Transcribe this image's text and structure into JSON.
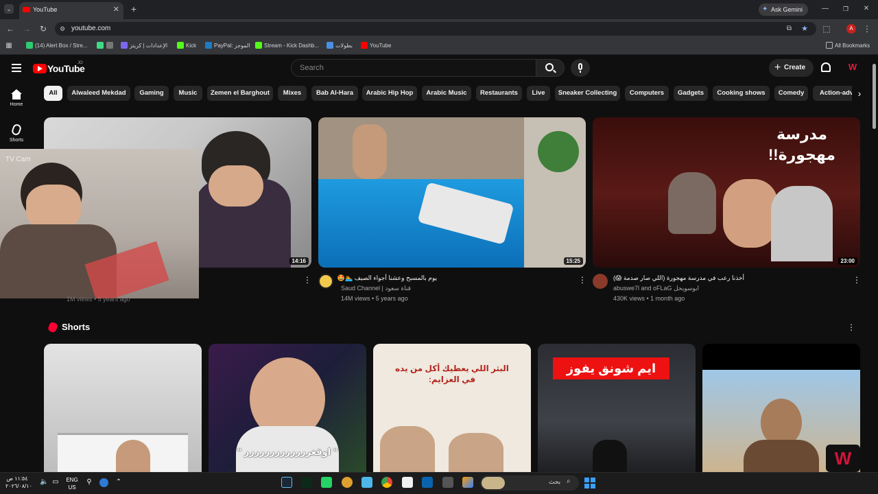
{
  "browser": {
    "tab_title": "YouTube",
    "new_tab": "+",
    "url": "youtube.com",
    "ask_gemini": "Ask Gemini",
    "profile_initial": "A",
    "bookmarks": [
      {
        "label": "(14) Alert Box / Stre...",
        "color": "#2ecc71"
      },
      {
        "label": "",
        "color": "#3ddc84"
      },
      {
        "label": "",
        "color": "#777777"
      },
      {
        "label": "الإعدادات | كريتز",
        "color": "#7b68ee"
      },
      {
        "label": "Kick",
        "color": "#53fc18"
      },
      {
        "label": "PayPal: الموجز",
        "color": "#1f7bc1"
      },
      {
        "label": "Stream - Kick Dashb...",
        "color": "#53fc18"
      },
      {
        "label": "بطولات",
        "color": "#4a90e2"
      },
      {
        "label": "YouTube",
        "color": "#ff0000"
      }
    ],
    "all_bookmarks": "All Bookmarks"
  },
  "yt": {
    "logo_text": "YouTube",
    "country": "JO",
    "search_placeholder": "Search",
    "create_label": "Create",
    "nav": [
      {
        "label": "Home",
        "icon": "home-icon"
      },
      {
        "label": "Shorts",
        "icon": "shorts-icon"
      }
    ],
    "chips": [
      "All",
      "Alwaleed Mekdad",
      "Gaming",
      "Music",
      "Zemen el Barghout",
      "Mixes",
      "Bab Al-Hara",
      "Arabic Hip Hop",
      "Arabic Music",
      "Restaurants",
      "Live",
      "Sneaker Collecting",
      "Computers",
      "Gadgets",
      "Cooking shows",
      "Comedy",
      "Action-adv"
    ],
    "videos": [
      {
        "duration": "14:16",
        "title": "",
        "channel": "",
        "meta": "1M views • 5 years ago",
        "overlay_label": "TV Cam"
      },
      {
        "duration": "15:25",
        "title": "يوم بالمسبح وعشنا أجواء الصيف 🏊🤩",
        "channel": "Saud Channel | قناة سعود",
        "meta": "14M views • 5 years ago"
      },
      {
        "duration": "23:00",
        "title": "أخذنا رعب في مدرسة مهجورة (اللي صار صدمة 😱)",
        "channel": "abuswe7l and oFLaG ابوسويحل",
        "meta": "430K views • 1 month ago",
        "thumb_text": "مدرسة مهجورة!!"
      }
    ],
    "shorts_heading": "Shorts",
    "shorts": [
      {
        "caption": ""
      },
      {
        "caption": "\" اوقغررررررررررررر \""
      },
      {
        "caption": "البثر اللي يعطيك أكل من يده في العزايم:"
      },
      {
        "caption": "ايم شونق يفوز"
      },
      {
        "caption": ""
      }
    ]
  },
  "taskbar": {
    "time": "١١:٥٤ ص",
    "date": "٢٠٢٦/٠٨/١٠",
    "lang": "ENG",
    "region": "US",
    "search_label": "بحث"
  }
}
